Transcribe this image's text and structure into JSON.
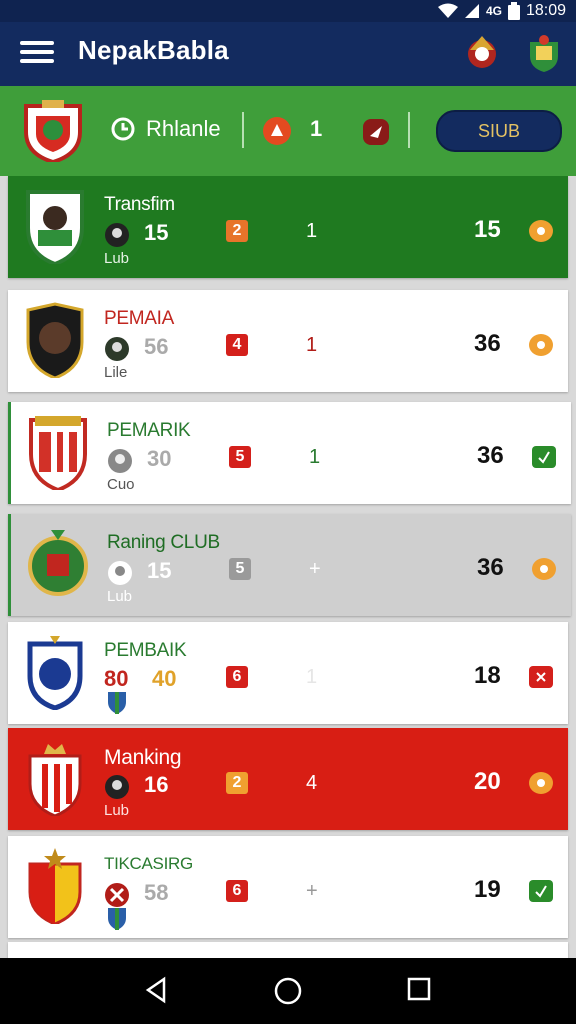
{
  "status": {
    "time": "18:09"
  },
  "app": {
    "title": "NepakBabla"
  },
  "filter": {
    "label": "Rhlanle",
    "count": "1",
    "button": "SIUB"
  },
  "rows": [
    {
      "name": "Transfim",
      "value": "15",
      "sub": "Lub",
      "badge": "2",
      "mid": "1",
      "score": "15",
      "status": "orange"
    },
    {
      "name": "PEMAIA",
      "value": "56",
      "sub": "Lile",
      "badge": "4",
      "mid": "1",
      "score": "36",
      "status": "orange"
    },
    {
      "name": "PEMARIK",
      "value": "30",
      "sub": "Cuo",
      "badge": "5",
      "mid": "1",
      "score": "36",
      "status": "green"
    },
    {
      "name": "Raning CLUB",
      "value": "15",
      "sub": "Lub",
      "badge": "5",
      "mid": "+",
      "score": "36",
      "status": "orange"
    },
    {
      "name": "PEMBAIK",
      "value": "40",
      "value_prefix": "80",
      "sub": "",
      "badge": "6",
      "mid": "1",
      "score": "18",
      "status": "red"
    },
    {
      "name": "Manking",
      "value": "16",
      "sub": "Lub",
      "badge": "2",
      "mid": "4",
      "score": "20",
      "status": "orange"
    },
    {
      "name": "TIKCASIRG",
      "value": "58",
      "sub": "",
      "badge": "6",
      "mid": "+",
      "score": "19",
      "status": "green"
    }
  ]
}
